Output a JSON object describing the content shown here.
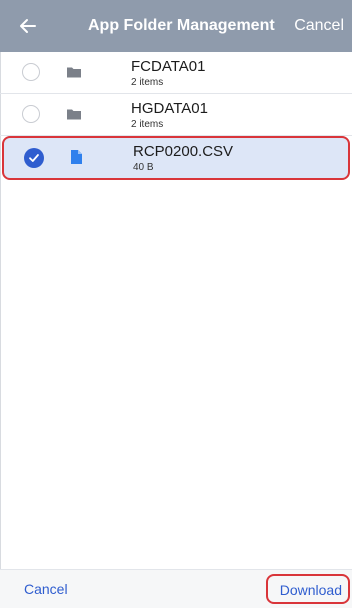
{
  "header": {
    "title": "App Folder Management",
    "cancel_label": "Cancel",
    "back_icon": "arrow-left-icon",
    "background": "#8f9bac"
  },
  "files": [
    {
      "name": "FCDATA01",
      "meta": "2 items",
      "kind": "folder",
      "selected": false
    },
    {
      "name": "HGDATA01",
      "meta": "2 items",
      "kind": "folder",
      "selected": false
    },
    {
      "name": "RCP0200.CSV",
      "meta": "40 B",
      "kind": "file",
      "selected": true
    }
  ],
  "footer": {
    "cancel_label": "Cancel",
    "download_label": "Download"
  },
  "colors": {
    "accent": "#2f5dcf",
    "highlight": "#d9353a",
    "selected_row": "#dde6f7",
    "folder_icon": "#7b8089",
    "file_icon": "#2f80ed"
  }
}
